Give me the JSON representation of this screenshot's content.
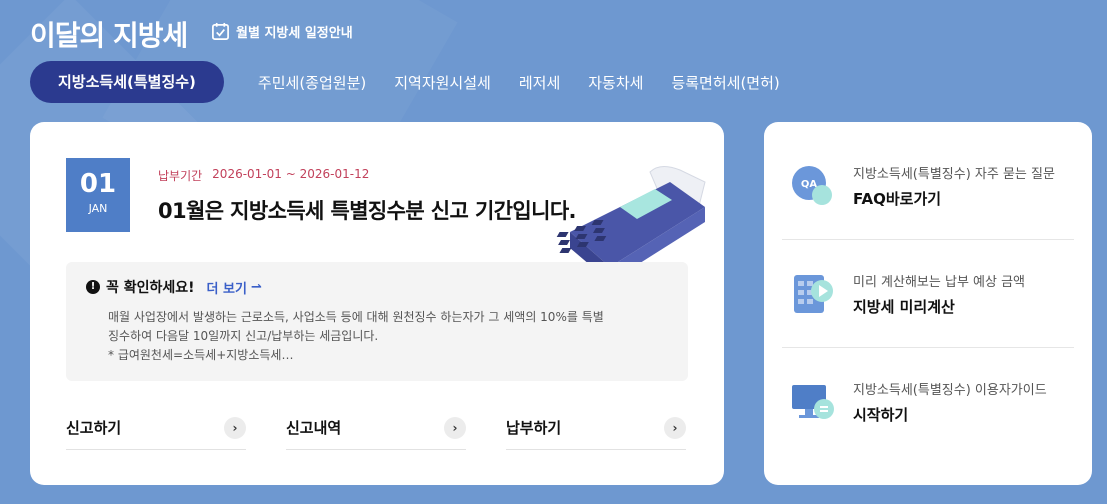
{
  "header": {
    "title": "이달의 지방세",
    "schedule_link": "월별 지방세 일정안내"
  },
  "tabs": [
    {
      "label": "지방소득세(특별징수)",
      "active": true
    },
    {
      "label": "주민세(종업원분)",
      "active": false
    },
    {
      "label": "지역자원시설세",
      "active": false
    },
    {
      "label": "레저세",
      "active": false
    },
    {
      "label": "자동차세",
      "active": false
    },
    {
      "label": "등록면허세(면허)",
      "active": false
    }
  ],
  "main": {
    "date_day": "01",
    "date_month": "JAN",
    "period_label": "납부기간",
    "period_value": "2026-01-01 ~ 2026-01-12",
    "headline": "01월은 지방소득세 특별징수분 신고 기간입니다.",
    "notice": {
      "title": "꼭 확인하세요!",
      "more": "더 보기",
      "body_line1": "매월 사업장에서 발생하는 근로소득, 사업소득 등에 대해 원천징수 하는자가 그 세액의 10%를 특별",
      "body_line2": "징수하여 다음달 10일까지 신고/납부하는 세금입니다.",
      "body_line3": "* 급여원천세=소득세+지방소득세…"
    },
    "actions": [
      "신고하기",
      "신고내역",
      "납부하기"
    ]
  },
  "side": [
    {
      "sub": "지방소득세(특별징수) 자주 묻는 질문",
      "title": "FAQ바로가기",
      "icon": "qa-icon"
    },
    {
      "sub": "미리 계산해보는 납부 예상 금액",
      "title": "지방세 미리계산",
      "icon": "calculator-icon"
    },
    {
      "sub": "지방소득세(특별징수) 이용자가이드",
      "title": "시작하기",
      "icon": "monitor-guide-icon"
    }
  ],
  "colors": {
    "background": "#6e98d0",
    "active_tab": "#2b3a8f",
    "date_box": "#4f7ec7",
    "period_text": "#c2415b",
    "link": "#3a5fc8"
  }
}
